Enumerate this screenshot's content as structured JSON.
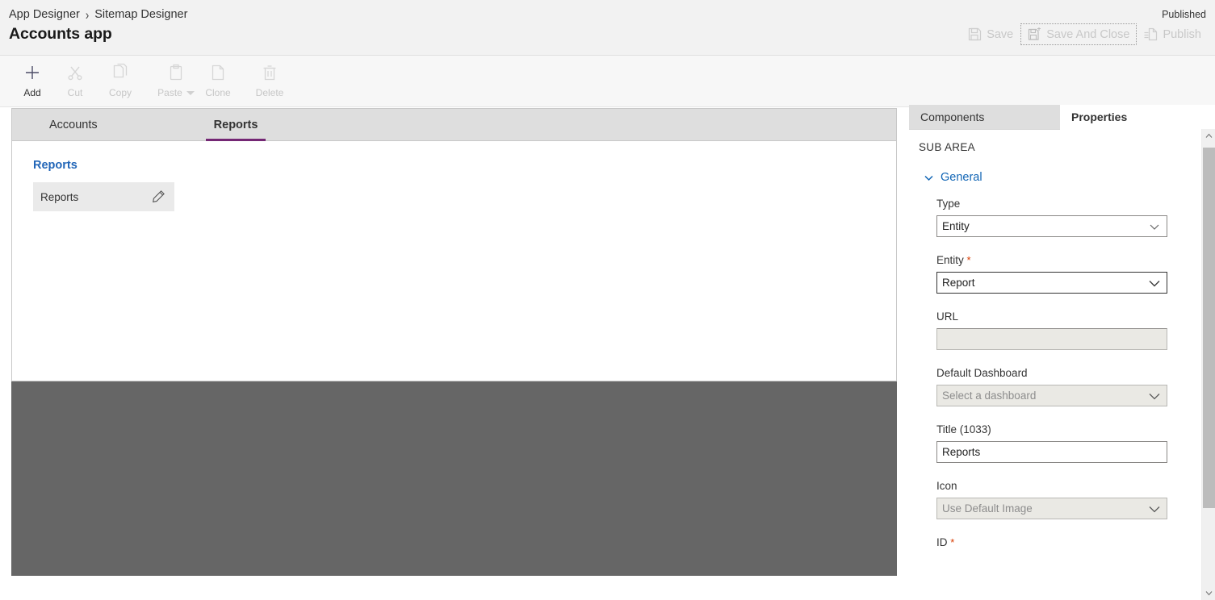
{
  "header": {
    "breadcrumb": [
      {
        "label": "App Designer"
      },
      {
        "label": "Sitemap Designer"
      }
    ],
    "separator": "›",
    "app_title": "Accounts app",
    "status": "Published",
    "actions": [
      {
        "label": "Save",
        "icon": "save-icon",
        "state": "disabled"
      },
      {
        "label": "Save And Close",
        "icon": "save-and-close-icon",
        "state": "focused"
      },
      {
        "label": "Publish",
        "icon": "publish-icon",
        "state": "disabled"
      }
    ]
  },
  "commandbar": {
    "items": [
      {
        "label": "Add",
        "icon": "plus-icon",
        "enabled": true,
        "has_caret": false
      },
      {
        "label": "Cut",
        "icon": "scissors-icon",
        "enabled": false,
        "has_caret": false
      },
      {
        "label": "Copy",
        "icon": "copy-icon",
        "enabled": false,
        "has_caret": false
      },
      {
        "label": "Paste",
        "icon": "clipboard-icon",
        "enabled": false,
        "has_caret": true
      },
      {
        "label": "Clone",
        "icon": "clone-icon",
        "enabled": false,
        "has_caret": false
      },
      {
        "label": "Delete",
        "icon": "trash-icon",
        "enabled": false,
        "has_caret": false
      }
    ]
  },
  "canvas": {
    "tabs": [
      {
        "label": "Accounts",
        "active": false
      },
      {
        "label": "Reports",
        "active": true
      }
    ],
    "group_title": "Reports",
    "tile": {
      "label": "Reports",
      "edit_icon": "pencil-icon"
    }
  },
  "panel": {
    "tabs": [
      {
        "label": "Components",
        "active": false
      },
      {
        "label": "Properties",
        "active": true
      }
    ],
    "section_header": "SUB AREA",
    "accordion": {
      "label": "General",
      "icon": "chevron-down-icon",
      "expanded": true
    },
    "fields": [
      {
        "label": "Type",
        "required": false,
        "control": "select",
        "value": "Entity",
        "placeholder": "",
        "state": "normal"
      },
      {
        "label": "Entity",
        "required": true,
        "control": "select",
        "value": "Report",
        "placeholder": "",
        "state": "focused"
      },
      {
        "label": "URL",
        "required": false,
        "control": "text",
        "value": "",
        "placeholder": "",
        "state": "disabled"
      },
      {
        "label": "Default Dashboard",
        "required": false,
        "control": "select",
        "value": "",
        "placeholder": "Select a dashboard",
        "state": "greyed"
      },
      {
        "label": "Title (1033)",
        "required": false,
        "control": "text",
        "value": "Reports",
        "placeholder": "",
        "state": "normal"
      },
      {
        "label": "Icon",
        "required": false,
        "control": "select",
        "value": "",
        "placeholder": "Use Default Image",
        "state": "greyed"
      },
      {
        "label": "ID",
        "required": true,
        "control": "text",
        "value": "",
        "placeholder": "",
        "state": "normal"
      }
    ],
    "required_marker": "*",
    "scrollbar": {
      "up_icon": "chevron-up-icon",
      "down_icon": "chevron-down-icon"
    }
  },
  "colors": {
    "accent_purple": "#742774",
    "link_blue": "#2266b8",
    "accordion_blue": "#1165b5",
    "required_red": "#d83b01",
    "dim_overlay": "#666666",
    "header_bg": "#f2f2f2",
    "tabstrip_bg": "#dedede"
  }
}
